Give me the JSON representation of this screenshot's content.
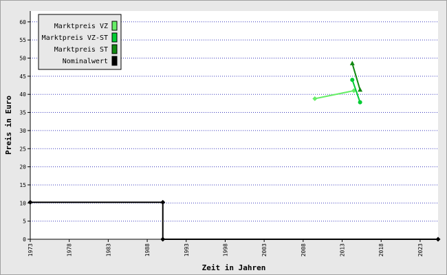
{
  "chart_data": {
    "type": "line",
    "xlabel": "Zeit in Jahren",
    "ylabel": "Preis in Euro",
    "xlim": [
      1973,
      2025.3
    ],
    "ylim": [
      0,
      63
    ],
    "x_ticks": [
      1973,
      1978,
      1983,
      1988,
      1993,
      1998,
      2003,
      2008,
      2013,
      2018,
      2023
    ],
    "y_ticks": [
      0,
      5,
      10,
      15,
      20,
      25,
      30,
      35,
      40,
      45,
      50,
      55,
      60
    ],
    "grid": "horizontal dotted",
    "legend_position": "top-left",
    "series": [
      {
        "name": "Marktpreis VZ",
        "color": "#66ee66",
        "marker": "diamond",
        "points": [
          [
            2009.5,
            38.8
          ],
          [
            2014.5,
            41.0
          ]
        ]
      },
      {
        "name": "Marktpreis VZ-ST",
        "color": "#00cc33",
        "marker": "circle",
        "points": [
          [
            2014.3,
            44.0
          ],
          [
            2015.3,
            37.8
          ]
        ]
      },
      {
        "name": "Marktpreis ST",
        "color": "#118811",
        "marker": "triangle",
        "points": [
          [
            2014.3,
            48.5
          ],
          [
            2015.3,
            41.2
          ]
        ]
      },
      {
        "name": "Nominalwert",
        "color": "#000000",
        "marker": "diamond",
        "step": true,
        "points": [
          [
            1973,
            10.2
          ],
          [
            1990,
            10.2
          ],
          [
            1990,
            0
          ],
          [
            2025.3,
            0
          ]
        ]
      }
    ]
  }
}
